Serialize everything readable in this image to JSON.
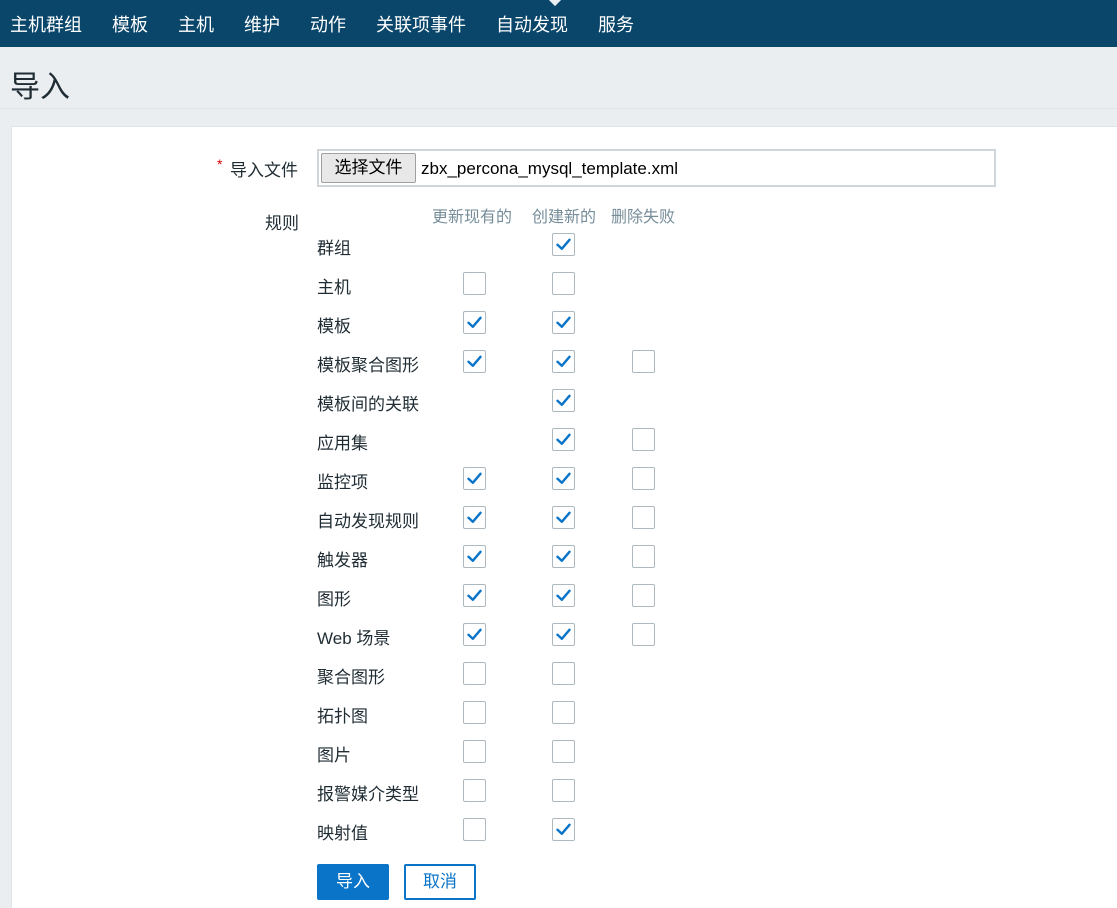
{
  "nav": {
    "items": [
      "主机群组",
      "模板",
      "主机",
      "维护",
      "动作",
      "关联项事件",
      "自动发现",
      "服务"
    ]
  },
  "page": {
    "title": "导入"
  },
  "form": {
    "file_label": "导入文件",
    "required_mark": "*",
    "file_button": "选择文件",
    "file_name": "zbx_percona_mysql_template.xml",
    "rules_label": "规则",
    "columns": [
      "更新现有的",
      "创建新的",
      "删除失败"
    ],
    "rows": [
      {
        "label": "群组",
        "update": null,
        "create": true,
        "delete": null
      },
      {
        "label": "主机",
        "update": false,
        "create": false,
        "delete": null
      },
      {
        "label": "模板",
        "update": true,
        "create": true,
        "delete": null
      },
      {
        "label": "模板聚合图形",
        "update": true,
        "create": true,
        "delete": false
      },
      {
        "label": "模板间的关联",
        "update": null,
        "create": true,
        "delete": null
      },
      {
        "label": "应用集",
        "update": null,
        "create": true,
        "delete": false
      },
      {
        "label": "监控项",
        "update": true,
        "create": true,
        "delete": false
      },
      {
        "label": "自动发现规则",
        "update": true,
        "create": true,
        "delete": false
      },
      {
        "label": "触发器",
        "update": true,
        "create": true,
        "delete": false
      },
      {
        "label": "图形",
        "update": true,
        "create": true,
        "delete": false
      },
      {
        "label": "Web 场景",
        "update": true,
        "create": true,
        "delete": false
      },
      {
        "label": "聚合图形",
        "update": false,
        "create": false,
        "delete": null
      },
      {
        "label": "拓扑图",
        "update": false,
        "create": false,
        "delete": null
      },
      {
        "label": "图片",
        "update": false,
        "create": false,
        "delete": null
      },
      {
        "label": "报警媒介类型",
        "update": false,
        "create": false,
        "delete": null
      },
      {
        "label": "映射值",
        "update": false,
        "create": true,
        "delete": null
      }
    ],
    "import_button": "导入",
    "cancel_button": "取消"
  },
  "colors": {
    "nav_bg": "#0a466a",
    "accent": "#0a74c8",
    "checkbox_border": "#aeb9bf"
  }
}
